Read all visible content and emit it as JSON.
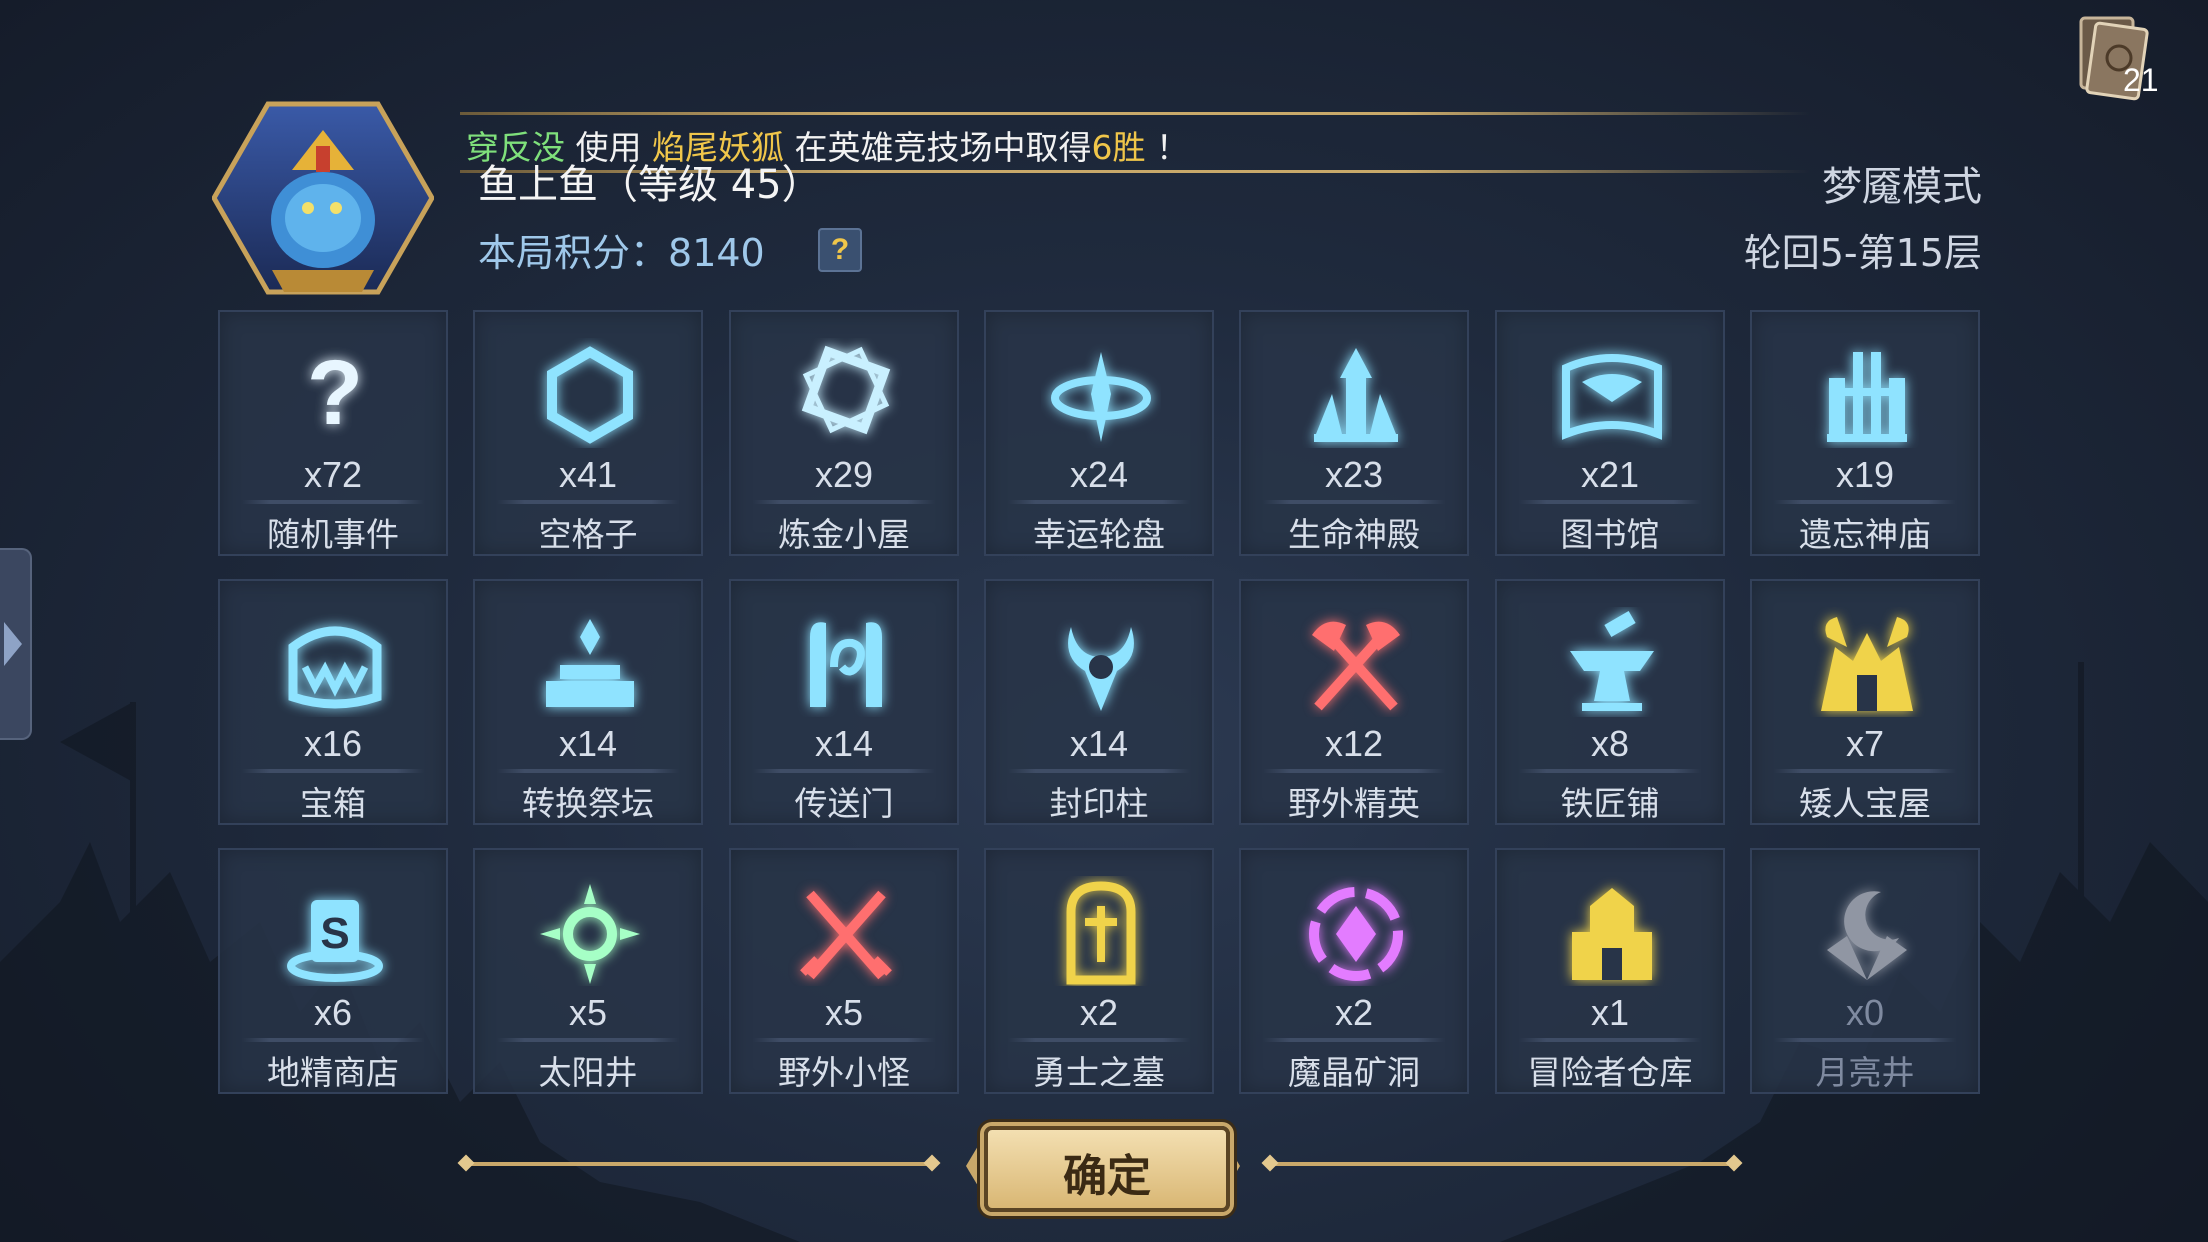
{
  "header": {
    "ticker": {
      "player": "穿反没",
      "verb": "使用",
      "hero": "焰尾妖狐",
      "middle": "在英雄竞技场中取得",
      "wins": "6胜",
      "end": "！"
    },
    "player_name": "鱼上鱼（等级 45）",
    "score_label": "本局积分：",
    "score_value": "8140",
    "help": "?",
    "mode": "梦魇模式",
    "floor": "轮回5-第15层",
    "deck_count": "21"
  },
  "events": [
    {
      "count": "x72",
      "name": "随机事件",
      "icon": "question-icon",
      "color": "#e8f6ff"
    },
    {
      "count": "x41",
      "name": "空格子",
      "icon": "hexagon-icon",
      "color": "#8fe3ff"
    },
    {
      "count": "x29",
      "name": "炼金小屋",
      "icon": "alchemy-icon",
      "color": "#c9f0ff"
    },
    {
      "count": "x24",
      "name": "幸运轮盘",
      "icon": "wheel-icon",
      "color": "#8fe3ff"
    },
    {
      "count": "x23",
      "name": "生命神殿",
      "icon": "temple-icon",
      "color": "#8fe3ff"
    },
    {
      "count": "x21",
      "name": "图书馆",
      "icon": "book-icon",
      "color": "#8fe3ff"
    },
    {
      "count": "x19",
      "name": "遗忘神庙",
      "icon": "shrine-icon",
      "color": "#8fe3ff"
    },
    {
      "count": "x16",
      "name": "宝箱",
      "icon": "chest-icon",
      "color": "#8fe3ff"
    },
    {
      "count": "x14",
      "name": "转换祭坛",
      "icon": "altar-icon",
      "color": "#8fe3ff"
    },
    {
      "count": "x14",
      "name": "传送门",
      "icon": "portal-icon",
      "color": "#8fe3ff"
    },
    {
      "count": "x14",
      "name": "封印柱",
      "icon": "seal-icon",
      "color": "#8fe3ff"
    },
    {
      "count": "x12",
      "name": "野外精英",
      "icon": "axes-icon",
      "color": "#ff6f6f"
    },
    {
      "count": "x8",
      "name": "铁匠铺",
      "icon": "anvil-icon",
      "color": "#8fe3ff"
    },
    {
      "count": "x7",
      "name": "矮人宝屋",
      "icon": "dwarf-icon",
      "color": "#f0d34a"
    },
    {
      "count": "x6",
      "name": "地精商店",
      "icon": "goblin-shop-icon",
      "color": "#8fe3ff"
    },
    {
      "count": "x5",
      "name": "太阳井",
      "icon": "sun-icon",
      "color": "#a6ffc6"
    },
    {
      "count": "x5",
      "name": "野外小怪",
      "icon": "swords-icon",
      "color": "#ff6f6f"
    },
    {
      "count": "x2",
      "name": "勇士之墓",
      "icon": "tomb-icon",
      "color": "#f0d34a"
    },
    {
      "count": "x2",
      "name": "魔晶矿洞",
      "icon": "crystal-icon",
      "color": "#e37cff"
    },
    {
      "count": "x1",
      "name": "冒险者仓库",
      "icon": "warehouse-icon",
      "color": "#f0d34a"
    },
    {
      "count": "x0",
      "name": "月亮井",
      "icon": "moon-icon",
      "color": "#e8e8f0"
    }
  ],
  "confirm_label": "确定"
}
